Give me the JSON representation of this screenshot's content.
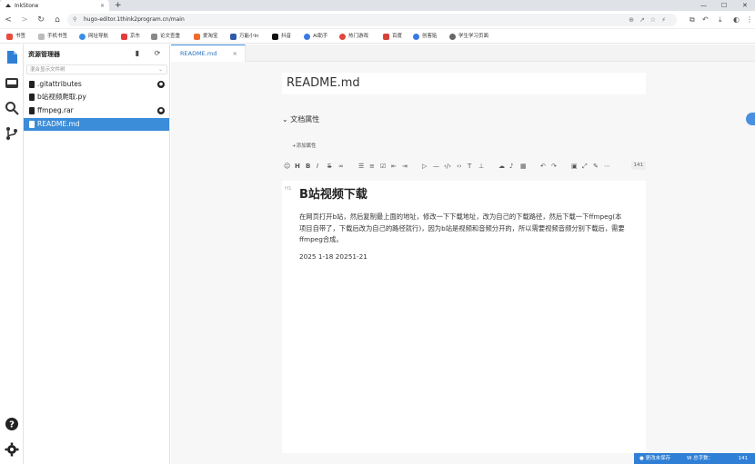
{
  "browser": {
    "tab_title": "InkStone",
    "tab_close": "×",
    "new_tab": "+",
    "url": "hugo-editor.1think2program.cn/main",
    "bookmarks": [
      "书签",
      "手机书签",
      "网址导航",
      "京东",
      "论文查重",
      "爱淘宝",
      "万能小In",
      "抖音",
      "AI助手",
      "热门游戏",
      "百度",
      "创客贴",
      "学生学习页面"
    ]
  },
  "explorer": {
    "title": "资源管理器",
    "view_mode": "混合显示文件树",
    "files": [
      {
        "name": ".gitattributes",
        "git": true,
        "active": false
      },
      {
        "name": "b站视频爬取.py",
        "git": false,
        "active": false
      },
      {
        "name": "ffmpeg.rar",
        "git": true,
        "active": false
      },
      {
        "name": "README.md",
        "git": false,
        "active": true
      }
    ]
  },
  "editor": {
    "tab_label": "README.md",
    "tab_close": "×",
    "doc_title": "README.md",
    "properties_label": "文档属性",
    "add_property": "+添加属性",
    "word_count_badge": "141",
    "heading_tag": "H1",
    "heading": "B站视频下载",
    "paragraph": "在网页打开b站，然后复制最上面的地址，修改一下下载地址，改为自己的下载路径，然后下载一下ffmpeg(本项目自带了，下载后改为自己的路径就行)，因为b站是视频和音频分开的，所以需要视频音频分别下载后，需要ffmpeg合成。",
    "date_line": "2025 1-18 20251-21"
  },
  "status": {
    "unsaved": "更改未保存",
    "word_count_label": "W 总字数：",
    "word_count": "141"
  },
  "colors": {
    "accent": "#3b8cd9",
    "status_bar": "#2f7fd6"
  }
}
